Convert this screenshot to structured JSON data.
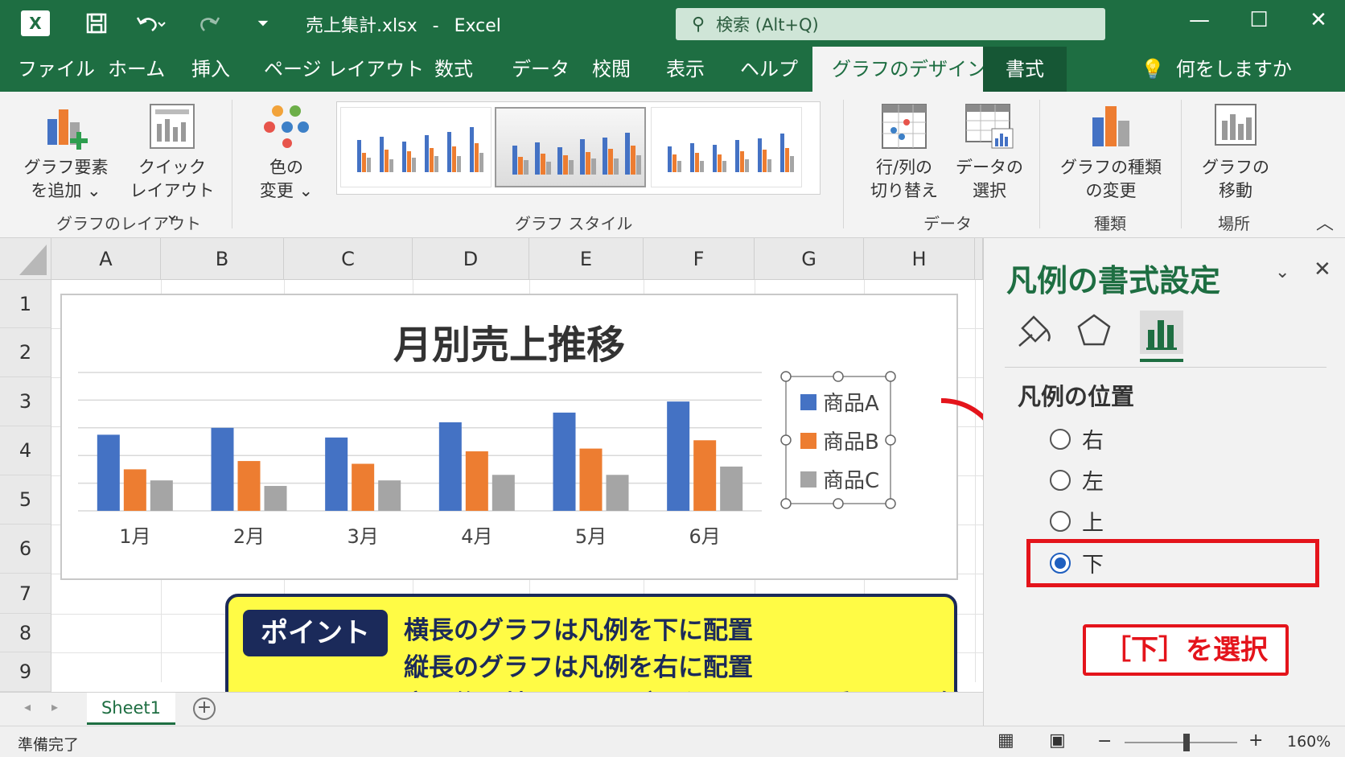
{
  "titlebar": {
    "app_icon": "X",
    "filename": "売上集計.xlsx",
    "separator": "-",
    "app": "Excel",
    "search_placeholder": "検索 (Alt+Q)"
  },
  "tabs": [
    "ファイル",
    "ホーム",
    "挿入",
    "ページ レイアウト",
    "数式",
    "データ",
    "校閲",
    "表示",
    "ヘルプ",
    "グラフのデザイン",
    "書式"
  ],
  "tell_me": "何をしますか",
  "ribbon": {
    "add_element": [
      "グラフ要素",
      "を追加 ⌄"
    ],
    "quick_layout": [
      "クイック",
      "レイアウト ⌄"
    ],
    "change_color": [
      "色の",
      "変更 ⌄"
    ],
    "group_layout": "グラフのレイアウト",
    "group_style": "グラフ スタイル",
    "switch_rowcol": [
      "行/列の",
      "切り替え"
    ],
    "select_data": [
      "データの",
      "選択"
    ],
    "group_data": "データ",
    "change_type": [
      "グラフの種類",
      "の変更"
    ],
    "group_type": "種類",
    "move_chart": [
      "グラフの",
      "移動"
    ],
    "group_location": "場所"
  },
  "columns": [
    "A",
    "B",
    "C",
    "D",
    "E",
    "F",
    "G",
    "H"
  ],
  "rows": [
    "1",
    "2",
    "3",
    "4",
    "5",
    "6",
    "7",
    "8",
    "9"
  ],
  "chart_data": {
    "type": "bar",
    "title": "月別売上推移",
    "categories": [
      "1月",
      "2月",
      "3月",
      "4月",
      "5月",
      "6月"
    ],
    "series": [
      {
        "name": "商品A",
        "color": "#4472c4",
        "values": [
          55,
          60,
          53,
          64,
          71,
          79
        ]
      },
      {
        "name": "商品B",
        "color": "#ed7d31",
        "values": [
          30,
          36,
          34,
          43,
          45,
          51
        ]
      },
      {
        "name": "商品C",
        "color": "#a5a5a5",
        "values": [
          22,
          18,
          22,
          26,
          26,
          32
        ]
      }
    ],
    "ylim": [
      0,
      100
    ],
    "grid": true,
    "legend": "right"
  },
  "point": {
    "tag": "ポイント",
    "lines": [
      "横長のグラフは凡例を下に配置",
      "縦長のグラフは凡例を右に配置",
      "変更後、軸ラベル・データラベルとの重なりを確認"
    ]
  },
  "sheet_tab": "Sheet1",
  "status": {
    "ready": "準備完了",
    "zoom_minus": "−",
    "zoom_plus": "+",
    "zoom": "160%",
    "zoom_level_percent": 55
  },
  "pane": {
    "title": "凡例の書式設定",
    "section": "凡例の位置",
    "options": [
      "右",
      "左",
      "上",
      "下"
    ],
    "selected": "下"
  },
  "annotation": "［下］を選択",
  "colors": {
    "excel_green": "#1e6e42",
    "accent_red": "#e4141b",
    "point_bg": "#fffb45",
    "navy": "#1b2a5a"
  }
}
